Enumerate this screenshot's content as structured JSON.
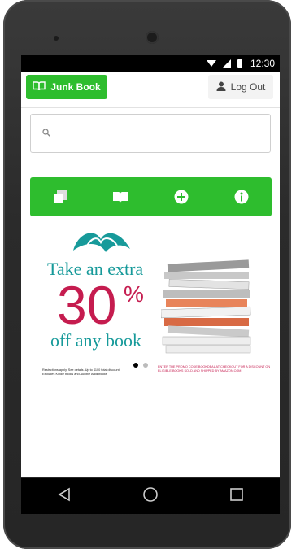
{
  "status_bar": {
    "time": "12:30"
  },
  "header": {
    "brand_label": "Junk Book",
    "logout_label": "Log Out"
  },
  "search": {
    "placeholder": "",
    "value": ""
  },
  "nav": {
    "icons": [
      "books-stack-icon",
      "open-book-icon",
      "plus-circle-icon",
      "info-circle-icon"
    ]
  },
  "banner": {
    "line1": "Take an extra",
    "big_number": "30",
    "percent": "%",
    "line3": "off any book",
    "fine_print_left": "Restrictions apply. See details. Up to $100 total discount. Excludes Kindle books and Audible Audiobooks",
    "fine_print_right": "ENTER THE PROMO CODE BOOKDEAL AT CHECKOUT FOR A DISCOUNT ON ELIGIBLE BOOKS SOLD AND SHIPPED BY AMAZON.COM",
    "slides_total": 2,
    "active_slide": 1
  },
  "colors": {
    "accent": "#2ebd2e",
    "teal": "#179a9a",
    "crimson": "#c51c4f"
  }
}
